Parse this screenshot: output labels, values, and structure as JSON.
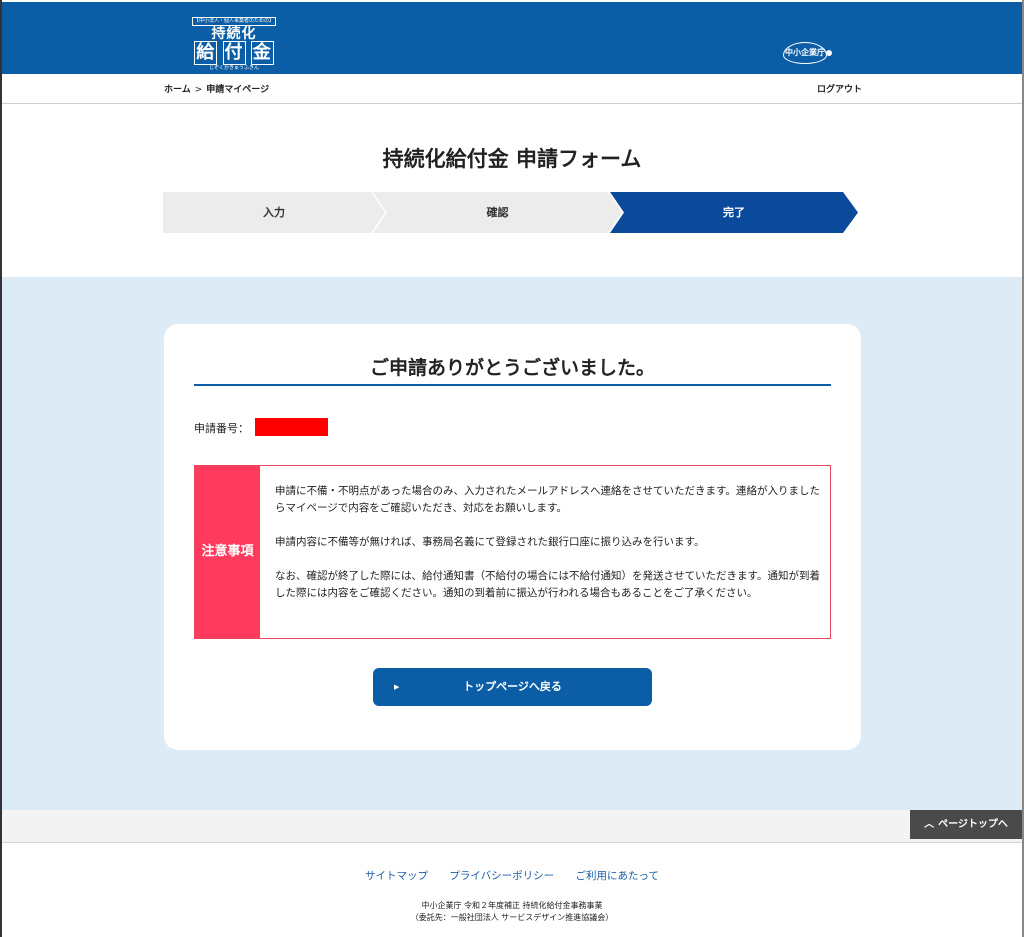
{
  "header": {
    "logo_top": "【中小法人・個人事業者のための】",
    "logo_line1": "持続化",
    "logo_line2": [
      "給",
      "付",
      "金"
    ],
    "logo_ruby": "じぞくかきゅうふきん",
    "agency_logo": "中小企業庁"
  },
  "breadcrumb": {
    "home": "ホーム",
    "separator": ">",
    "current": "申請マイページ",
    "logout": "ログアウト"
  },
  "form": {
    "title": "持続化給付金 申請フォーム",
    "steps": [
      "入力",
      "確認",
      "完了"
    ],
    "active_step": 3
  },
  "result": {
    "thanks": "ご申請ありがとうございました。",
    "application_number_label": "申請番号：",
    "application_number_value": "",
    "notice_heading": "注意事項",
    "notice_paragraphs": [
      "申請に不備・不明点があった場合のみ、入力されたメールアドレスへ連絡をさせていただきます。連絡が入りましたらマイページで内容をご確認いただき、対応をお願いします。",
      "申請内容に不備等が無ければ、事務局名義にて登録された銀行口座に振り込みを行います。",
      "なお、確認が終了した際には、給付通知書（不給付の場合には不給付通知）を発送させていただきます。通知が到着した際には内容をご確認ください。通知の到着前に振込が行われる場合もあることをご了承ください。"
    ],
    "back_button": "トップページへ戻る"
  },
  "pagetop": "ページトップへ",
  "footer": {
    "links": [
      "サイトマップ",
      "プライバシーポリシー",
      "ご利用にあたって"
    ],
    "credit_line1": "中小企業庁 令和２年度補正 持続化給付金事務事業",
    "credit_line2": "（委託先：一般社団法人 サービスデザイン推進協議会）"
  },
  "colors": {
    "header_blue": "#0b5ea5",
    "active_step": "#0b4a9a",
    "notice_red": "#ff3a5c",
    "band_light_blue": "#dcebf5"
  }
}
